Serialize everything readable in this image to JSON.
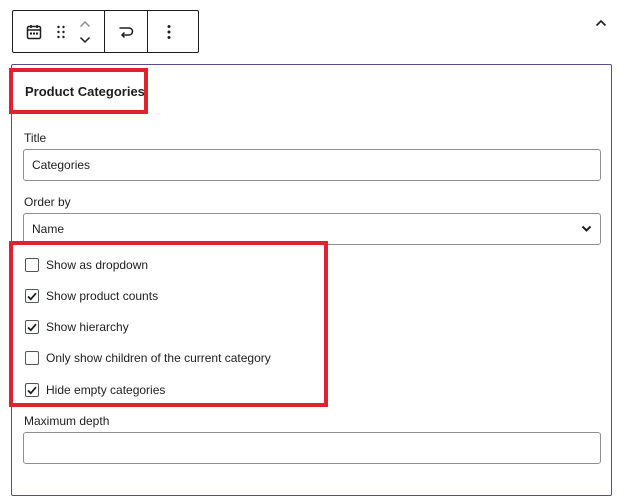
{
  "toolbar": {
    "icons": [
      "calendar-icon",
      "drag-handle-icon",
      "chevron-up-icon",
      "chevron-down-icon",
      "transform-icon",
      "more-vertical-icon"
    ]
  },
  "panel": {
    "title": "Product Categories",
    "title_field": {
      "label": "Title",
      "value": "Categories"
    },
    "order_field": {
      "label": "Order by",
      "selected": "Name"
    },
    "options": [
      {
        "label": "Show as dropdown",
        "checked": false
      },
      {
        "label": "Show product counts",
        "checked": true
      },
      {
        "label": "Show hierarchy",
        "checked": true
      },
      {
        "label": "Only show children of the current category",
        "checked": false
      },
      {
        "label": "Hide empty categories",
        "checked": true
      }
    ],
    "depth_field": {
      "label": "Maximum depth",
      "value": ""
    }
  },
  "colors": {
    "highlight": "#e0222f",
    "panel_border": "#5b4a8c",
    "text": "#1e1e1e"
  }
}
